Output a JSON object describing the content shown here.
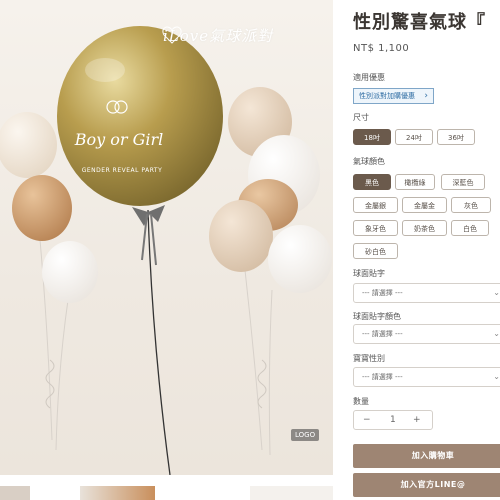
{
  "photo": {
    "brand_text": "iLove氣球派對",
    "balloon_text": "Boy or Girl",
    "balloon_subtext": "GENDER REVEAL PARTY",
    "badge_text": "LOGO"
  },
  "product": {
    "title": "性別驚喜氣球『",
    "price": "NT$ 1,100"
  },
  "promo": {
    "label": "適用優惠",
    "tag": "性別派對加購優惠",
    "chevron": "›"
  },
  "size": {
    "label": "尺寸",
    "options": [
      "18吋",
      "24吋",
      "36吋"
    ],
    "selected": "18吋"
  },
  "color": {
    "label": "氣球顏色",
    "options": [
      "黑色",
      "橄欖綠",
      "深藍色",
      "金屬銀",
      "金屬金",
      "灰色",
      "象牙色",
      "奶茶色",
      "白色",
      "砂白色"
    ],
    "selected": "黑色"
  },
  "sticker": {
    "label": "球面貼字",
    "placeholder": "--- 請選擇 ---"
  },
  "sticker_color": {
    "label": "球面貼字顏色",
    "placeholder": "--- 請選擇 ---"
  },
  "gender": {
    "label": "寶寶性別",
    "placeholder": "--- 請選擇 ---"
  },
  "quantity": {
    "label": "數量",
    "minus": "−",
    "value": "1",
    "plus": "+"
  },
  "buttons": {
    "add_to_cart": "加入購物車",
    "line": "加入官方LINE@"
  },
  "colors": {
    "accent": "#9e8573",
    "selected": "#6b5a4c",
    "promo_blue": "#2f6da3"
  }
}
